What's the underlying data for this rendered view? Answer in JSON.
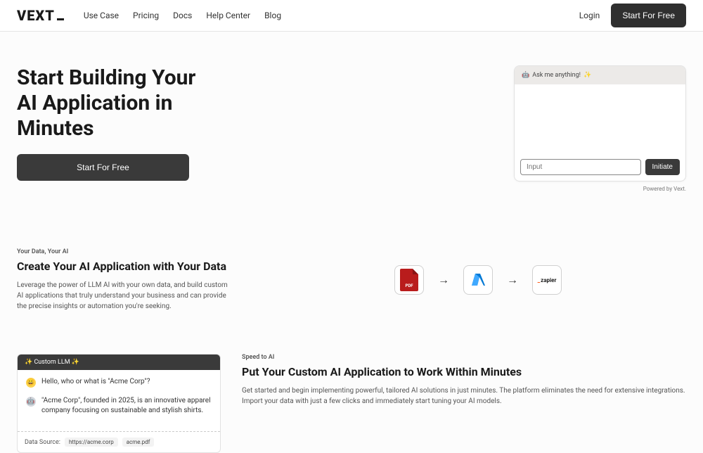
{
  "header": {
    "logo_text": "VEXT",
    "nav": {
      "use_case": "Use Case",
      "pricing": "Pricing",
      "docs": "Docs",
      "help": "Help Center",
      "blog": "Blog"
    },
    "login": "Login",
    "cta": "Start For Free"
  },
  "hero": {
    "title": "Start Building Your AI Application in Minutes",
    "cta": "Start For Free",
    "chat": {
      "header_prefix": "🤖",
      "header_text": "Ask me anything!",
      "header_suffix": "✨",
      "input_placeholder": "Input",
      "send": "Initiate",
      "powered": "Powered by Vext."
    }
  },
  "section2": {
    "eyebrow": "Your Data, Your AI",
    "title": "Create Your AI Application with Your Data",
    "body": "Leverage the power of LLM AI with your own data, and build custom AI applications that truly understand your business and can provide the precise insights or automation you're seeking.",
    "flow": {
      "pdf_label": "PDF",
      "zapier_label": "zapier"
    }
  },
  "section3": {
    "eyebrow": "Speed to AI",
    "title": "Put Your Custom AI Application to Work Within Minutes",
    "body": "Get started and begin implementing powerful, tailored AI solutions in just minutes. The platform eliminates the need for extensive integrations. Import your data with just a few clicks and immediately start tuning your AI models.",
    "llm": {
      "header": "✨ Custom LLM ✨",
      "user_msg": "Hello, who or what is \"Acme Corp\"?",
      "bot_msg": "\"Acme Corp\", founded in 2025, is an innovative apparel company focusing on sustainable and stylish shirts.",
      "source_label": "Data Source:",
      "sources": {
        "a": "https://acme.corp",
        "b": "acme.pdf"
      }
    }
  }
}
